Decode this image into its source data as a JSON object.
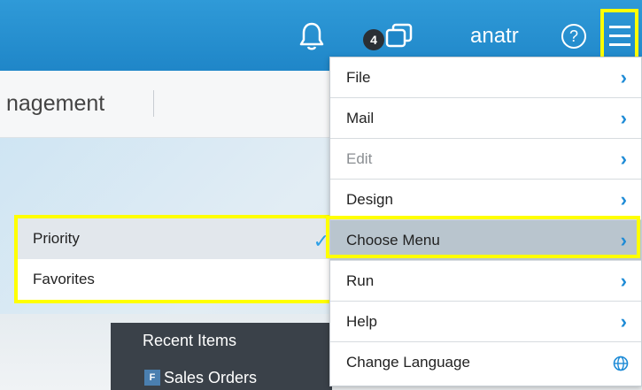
{
  "header": {
    "notification_count": "4",
    "username": "anatr",
    "help_symbol": "?",
    "icons": [
      "bell-icon",
      "windows-icon",
      "help-icon",
      "hamburger-menu-icon"
    ],
    "brand_color": "#2f9ad8"
  },
  "title_strip": {
    "page_title": "nagement"
  },
  "main_menu": {
    "items": [
      {
        "label": "File"
      },
      {
        "label": "Mail"
      },
      {
        "label": "Edit"
      },
      {
        "label": "Design"
      },
      {
        "label": "Choose Menu"
      },
      {
        "label": "Run"
      },
      {
        "label": "Help"
      },
      {
        "label": "Change Language"
      }
    ],
    "highlight_color": "#ffff00"
  },
  "submenu": {
    "items": [
      {
        "label": "Priority",
        "checked": true
      },
      {
        "label": "Favorites",
        "checked": false
      }
    ]
  },
  "recent": {
    "header": "Recent Items",
    "item_icon": "F",
    "item_label": "Sales Orders"
  }
}
